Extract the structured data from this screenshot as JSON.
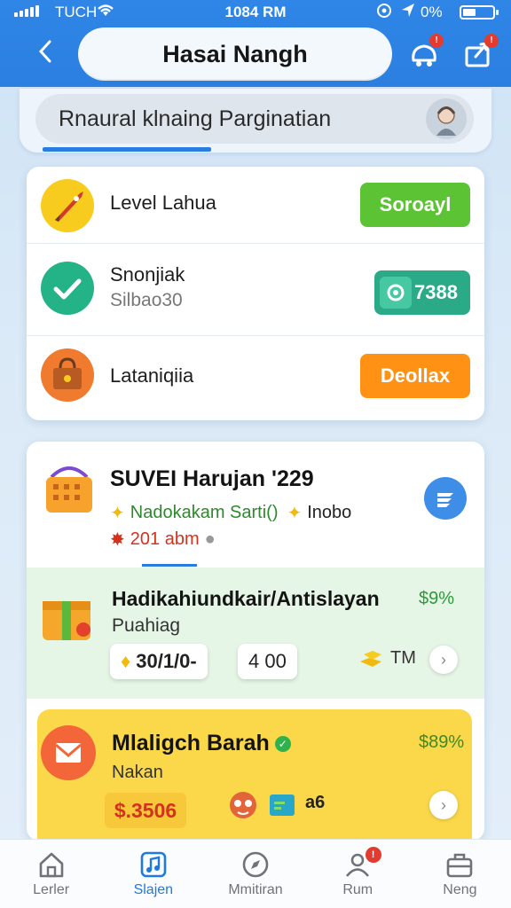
{
  "status_bar": {
    "carrier": "TUCH",
    "time": "1084 RM",
    "battery": "0%"
  },
  "header": {
    "title": "Hasai Nangh",
    "notifications_badge": "!",
    "share_badge": "!"
  },
  "search": {
    "placeholder": "Rnaural klnaing Parginatian"
  },
  "list": {
    "items": [
      {
        "label": "Level Lahua",
        "sub": "",
        "button": "Soroayl",
        "button_color": "#5cc334"
      },
      {
        "label": "Snonjiak",
        "sub": "Silbao30",
        "button": "7388",
        "button_color": "#2aaa86"
      },
      {
        "label": "Lataniqiia",
        "sub": "",
        "button": "Deollax",
        "button_color": "#ff9215"
      }
    ]
  },
  "feature": {
    "title": "SUVEI Harujan '229",
    "line1_a": "Nadokakam Sarti()",
    "line1_b": "Inobo",
    "price": "201 abm"
  },
  "promo_green": {
    "title": "Hadikahiundkair/Antislayan",
    "subtitle": "Puahiag",
    "percent": "$9%",
    "chip1": "30/1/0-",
    "chip2": "4 00",
    "tm_label": "TM"
  },
  "promo_yellow": {
    "title": "Mlaligch Barah",
    "subtitle": "Nakan",
    "percent": "$89%",
    "price": "$.3506",
    "extra": "a6"
  },
  "bottom_nav": {
    "items": [
      {
        "label": "Lerler",
        "active": false
      },
      {
        "label": "Slajen",
        "active": true
      },
      {
        "label": "Mmitiran",
        "active": false
      },
      {
        "label": "Rum",
        "active": false,
        "badge": "!"
      },
      {
        "label": "Neng",
        "active": false
      }
    ]
  },
  "colors": {
    "accent": "#2a7de0",
    "green_btn": "#5cc334",
    "teal_btn": "#2aaa86",
    "orange_btn": "#ff9215",
    "promo_green_bg": "#e6f6e6",
    "promo_yellow_bg": "#fbd84a"
  }
}
